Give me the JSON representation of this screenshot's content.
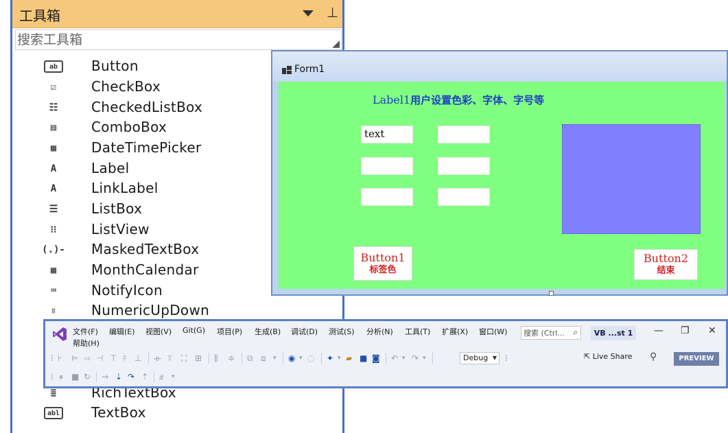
{
  "toolbox": {
    "title": "工具箱",
    "search_placeholder": "搜索工具箱",
    "items": [
      {
        "label": "Button",
        "icon": "button-icon",
        "glyph": "ab"
      },
      {
        "label": "CheckBox",
        "icon": "checkbox-icon",
        "glyph": "☑"
      },
      {
        "label": "CheckedListBox",
        "icon": "checkedlistbox-icon",
        "glyph": "☷"
      },
      {
        "label": "ComboBox",
        "icon": "combobox-icon",
        "glyph": "▤"
      },
      {
        "label": "DateTimePicker",
        "icon": "datetimepicker-icon",
        "glyph": "▦"
      },
      {
        "label": "Label",
        "icon": "label-icon",
        "glyph": "A"
      },
      {
        "label": "LinkLabel",
        "icon": "linklabel-icon",
        "glyph": "A"
      },
      {
        "label": "ListBox",
        "icon": "listbox-icon",
        "glyph": "☰"
      },
      {
        "label": "ListView",
        "icon": "listview-icon",
        "glyph": "⁝⁝"
      },
      {
        "label": "MaskedTextBox",
        "icon": "maskedtextbox-icon",
        "glyph": "(.)-"
      },
      {
        "label": "MonthCalendar",
        "icon": "monthcalendar-icon",
        "glyph": "▦"
      },
      {
        "label": "NotifyIcon",
        "icon": "notifyicon-icon",
        "glyph": "⌨"
      },
      {
        "label": "NumericUpDown",
        "icon": "numericupdown-icon",
        "glyph": "⇳"
      },
      {
        "label": "RichTextBox",
        "icon": "richtextbox-icon",
        "glyph": "≣"
      },
      {
        "label": "TextBox",
        "icon": "textbox-icon",
        "glyph": "abl"
      }
    ]
  },
  "form": {
    "title": "Form1",
    "label1": {
      "prefix": "Label1",
      "text": "用户设置色彩、字体、字号等"
    },
    "textbox1_value": "text",
    "button1": {
      "line1": "Button1",
      "line2": "标签色"
    },
    "button2": {
      "line1": "Button2",
      "line2": "结束"
    },
    "colors": {
      "client": "#80ff80",
      "panel": "#8080ff",
      "button_text": "#d02020",
      "label_text": "#1e3ec4"
    }
  },
  "vs": {
    "menu": [
      "文件(F)",
      "编辑(E)",
      "视图(V)",
      "Git(G)",
      "项目(P)",
      "生成(B)",
      "调试(D)",
      "测试(S)",
      "分析(N)",
      "工具(T)",
      "扩展(X)",
      "窗口(W)"
    ],
    "help": "帮助(H)",
    "search_placeholder": "搜索 (Ctrl...",
    "solution_name": "VB ...st 1",
    "config": "Debug",
    "live_share": "Live Share",
    "preview": "PREVIEW"
  }
}
